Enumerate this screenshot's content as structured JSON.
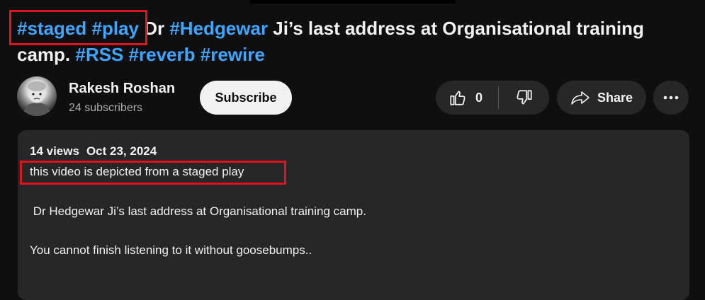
{
  "title": {
    "tag1": "#staged",
    "tag2": "#play",
    "text1": " Dr ",
    "tag3": "#Hedgewar",
    "text2": " Ji’s last address at Organisational training camp. ",
    "tag4": "#RSS",
    "tag5": "#reverb",
    "tag6": "#rewire"
  },
  "channel": {
    "name": "Rakesh Roshan",
    "subscribers": "24 subscribers",
    "subscribe_label": "Subscribe"
  },
  "actions": {
    "like_count": "0",
    "share_label": "Share"
  },
  "icons": {
    "like": "thumbs-up-icon",
    "dislike": "thumbs-down-icon",
    "share": "share-arrow-icon",
    "more": "more-horizontal-icon"
  },
  "description": {
    "views": "14 views",
    "date": "Oct 23, 2024",
    "lines": [
      "this video is depicted from a staged play",
      " Dr Hedgewar Ji’s last address at Organisational training camp.",
      "You cannot finish listening to it without goosebumps.."
    ]
  },
  "colors": {
    "background": "#0f0f0f",
    "hashtag": "#3ea6ff",
    "highlight_box": "#e0141e",
    "panel": "#272727"
  }
}
